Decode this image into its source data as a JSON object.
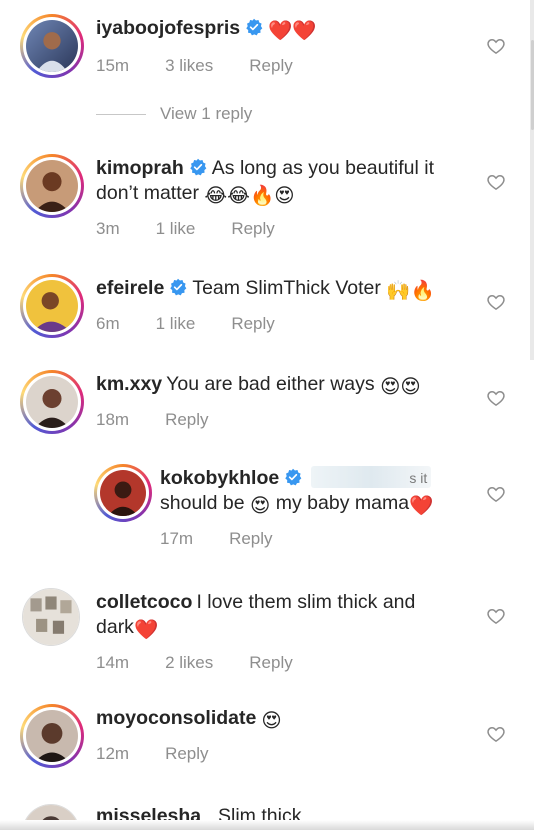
{
  "comments": [
    {
      "username": "iyaboojofespris",
      "verified": true,
      "text": "",
      "emojis": "❤️❤️",
      "time": "15m",
      "likes": "3 likes",
      "reply": "Reply",
      "avatar_color": "#3b4f7a"
    },
    {
      "username": "kimoprah",
      "verified": true,
      "text": "As long as you beautiful it",
      "text2": "don’t matter",
      "emojis": "😂😂🔥😍",
      "time": "3m",
      "likes": "1 like",
      "reply": "Reply",
      "avatar_color": "#7a4a30"
    },
    {
      "username": "efeirele",
      "verified": true,
      "text": "Team SlimThick Voter",
      "emojis": "🙌🔥",
      "time": "6m",
      "likes": "1 like",
      "reply": "Reply",
      "avatar_color": "#e0b13a"
    },
    {
      "username": "km.xxy",
      "verified": false,
      "text": "You are bad either ways",
      "emojis": "😍😍",
      "time": "18m",
      "reply": "Reply",
      "avatar_color": "#5a3b2c"
    },
    {
      "username": "kokobykhloe",
      "verified": true,
      "mention_tail": "s it",
      "text2a": "should be",
      "emoji_mid": "😍",
      "text2b": "my baby mama",
      "emoji_end": "❤️",
      "time": "17m",
      "reply": "Reply",
      "avatar_color": "#8a2a20"
    },
    {
      "username": "colletcoco",
      "verified": false,
      "text": "I love them slim thick and",
      "text2": "dark",
      "emoji_end": "❤️",
      "time": "14m",
      "likes": "2 likes",
      "reply": "Reply",
      "avatar_color": "#b9b1a6"
    },
    {
      "username": "moyoconsolidate",
      "verified": false,
      "emoji_end": "😍",
      "time": "12m",
      "reply": "Reply",
      "avatar_color": "#3a2a25"
    },
    {
      "username": "misselesha_",
      "verified": false,
      "text": "Slim thick",
      "avatar_color": "#4a3a35"
    }
  ],
  "view_replies": "View 1 reply",
  "colors": {
    "text": "#262626",
    "muted": "#8e8e8e",
    "verified_blue": "#3897f0",
    "heart_outline": "#8e8e8e"
  },
  "icons": {
    "verified": "verified-badge-icon",
    "like": "heart-outline-icon"
  }
}
